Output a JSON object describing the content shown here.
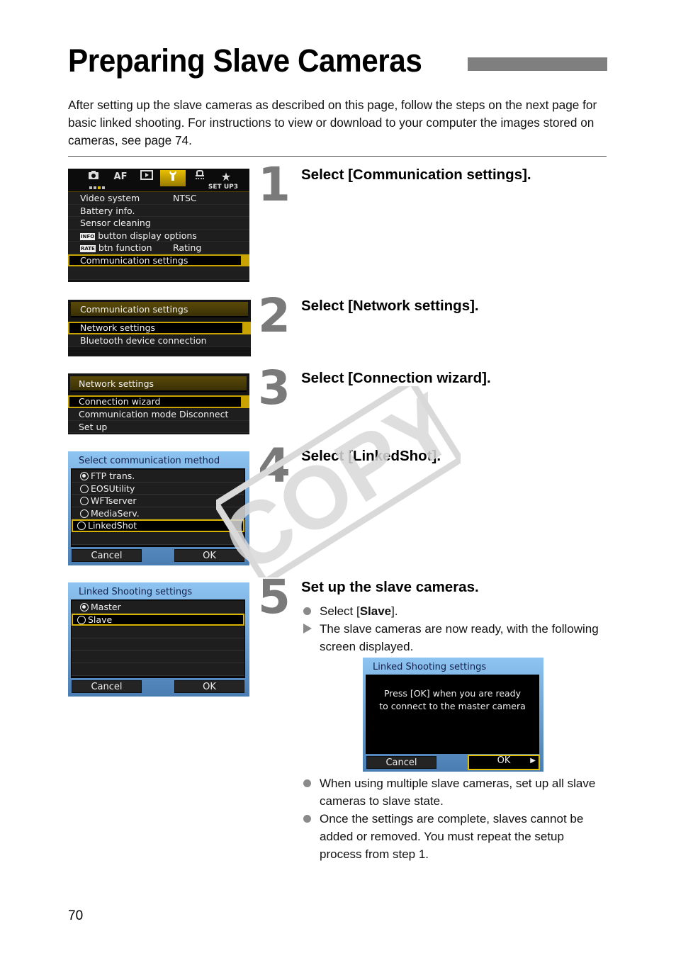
{
  "page": {
    "title": "Preparing Slave Cameras",
    "intro": "After setting up the slave cameras as described on this page, follow the steps on the next page for basic linked shooting. For instructions to view or download to your computer the images stored on cameras, see page 74.",
    "page_number": "70",
    "watermark": "COPY"
  },
  "steps": [
    {
      "number": "1",
      "title": "Select [Communication settings]."
    },
    {
      "number": "2",
      "title": "Select [Network settings]."
    },
    {
      "number": "3",
      "title": "Select [Connection wizard]."
    },
    {
      "number": "4",
      "title": "Select [LinkedShot]."
    },
    {
      "number": "5",
      "title": "Set up the slave cameras."
    }
  ],
  "step5": {
    "bullet1_pre": "Select [",
    "bullet1_bold": "Slave",
    "bullet1_post": "].",
    "result": "The slave cameras are now ready, with the following screen displayed.",
    "notes": [
      "When using multiple slave cameras, set up all slave cameras to slave state.",
      "Once the settings are complete, slaves cannot be added or removed. You must repeat the setup process from step 1."
    ]
  },
  "screens": {
    "setup_menu": {
      "tabs": [
        {
          "icon": "camera-icon",
          "label": "◘"
        },
        {
          "icon": "af-icon",
          "label": "AF"
        },
        {
          "icon": "playback-icon",
          "label": "▶"
        },
        {
          "icon": "wrench-icon",
          "label": "🔧"
        },
        {
          "icon": "custom-functions-icon",
          "label": "⌂"
        },
        {
          "icon": "star-icon",
          "label": "★"
        }
      ],
      "page_label": "SET UP3",
      "items": [
        {
          "label": "Video system",
          "value": "NTSC"
        },
        {
          "label": "Battery info.",
          "value": ""
        },
        {
          "label": "Sensor cleaning",
          "value": ""
        },
        {
          "badge": "INFO",
          "label": "button display options",
          "value": ""
        },
        {
          "badge": "RATE",
          "label": "btn function",
          "value": "Rating"
        },
        {
          "label": "Communication settings",
          "value": "",
          "selected": true
        }
      ]
    },
    "communication_settings": {
      "header": "Communication settings",
      "items": [
        {
          "label": "Network settings",
          "selected": true
        },
        {
          "label": "Bluetooth device connection"
        }
      ]
    },
    "network_settings": {
      "header": "Network settings",
      "items": [
        {
          "label": "Connection wizard",
          "selected": true
        },
        {
          "label": "Communication mode",
          "value": "Disconnect"
        },
        {
          "label": "Set up"
        }
      ]
    },
    "select_method": {
      "title": "Select communication method",
      "options": [
        {
          "label": "FTP trans.",
          "checked": true
        },
        {
          "label": "EOSUtility"
        },
        {
          "label": "WFTserver"
        },
        {
          "label": "MediaServ."
        },
        {
          "label": "LinkedShot",
          "selected": true
        }
      ],
      "cancel": "Cancel",
      "ok": "OK"
    },
    "linked_settings": {
      "title": "Linked Shooting settings",
      "options": [
        {
          "label": "Master",
          "checked": true
        },
        {
          "label": "Slave",
          "selected": true
        }
      ],
      "cancel": "Cancel",
      "ok": "OK"
    },
    "linked_ready": {
      "title": "Linked Shooting settings",
      "message_line1": "Press [OK] when you are ready",
      "message_line2": "to connect to the master camera",
      "cancel": "Cancel",
      "ok": "OK"
    }
  }
}
